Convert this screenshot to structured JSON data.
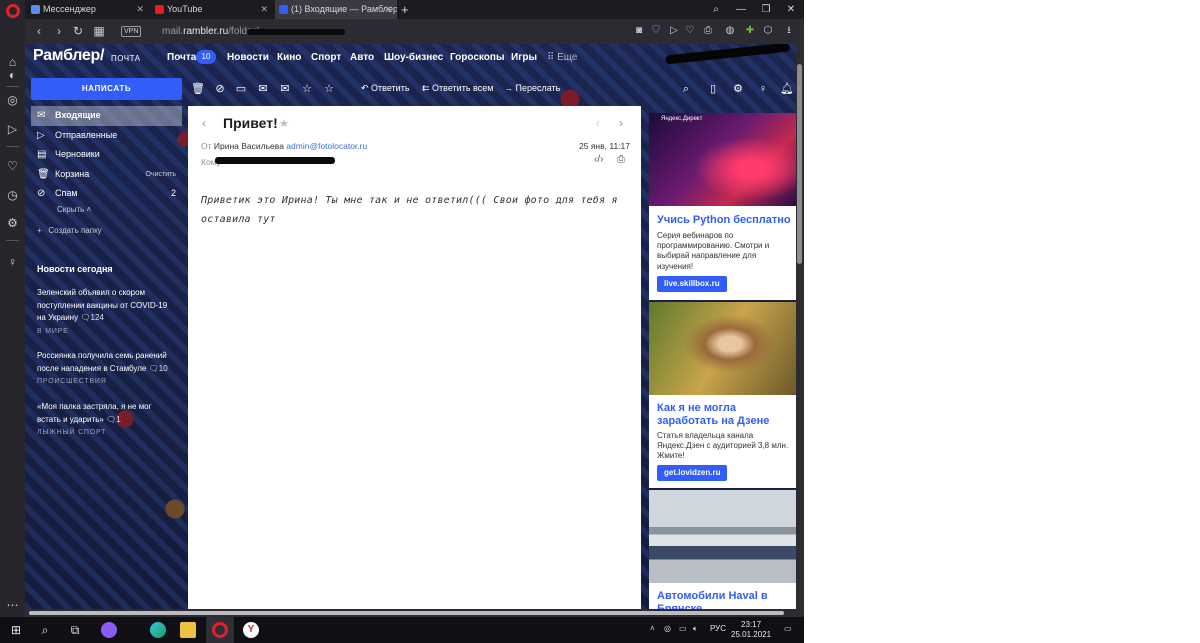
{
  "browser": {
    "tabs": [
      {
        "label": "Мессенджер",
        "icon": "messenger-icon"
      },
      {
        "label": "YouTube",
        "icon": "youtube-icon"
      },
      {
        "label": "(1) Входящие — Рамблер/",
        "icon": "mail-icon"
      }
    ],
    "vpn": "VPN",
    "url_prefix": "mail.",
    "url_domain": "rambler.ru",
    "url_path": "/folder/"
  },
  "header": {
    "logo": "Рамблер/",
    "logo_sub": "ПОЧТА",
    "nav": [
      "Почта",
      "Новости",
      "Кино",
      "Спорт",
      "Авто",
      "Шоу-бизнес",
      "Гороскопы",
      "Игры"
    ],
    "mail_count": "10",
    "more": "Еще"
  },
  "toolbar": {
    "compose": "НАПИСАТЬ",
    "reply": "Ответить",
    "reply_all": "Ответить всем",
    "forward": "Переслать"
  },
  "folders": [
    {
      "label": "Входящие",
      "icon": "inbox-icon",
      "active": true
    },
    {
      "label": "Отправленные",
      "icon": "sent-icon"
    },
    {
      "label": "Черновики",
      "icon": "drafts-icon"
    },
    {
      "label": "Корзина",
      "icon": "trash-icon",
      "action": "Очистить"
    },
    {
      "label": "Спам",
      "icon": "spam-icon",
      "count": "2"
    }
  ],
  "sidebar": {
    "hide": "Скрыть",
    "create_folder": "Создать папку",
    "news_heading": "Новости сегодня",
    "news": [
      {
        "text": "Зеленский объявил о скором поступлении вакцины от COVID-19 на Украину",
        "comments": "124",
        "category": "В МИРЕ"
      },
      {
        "text": "Россиянка получила семь ранений после нападения в Стамбуле",
        "comments": "10",
        "category": "ПРОИСШЕСТВИЯ"
      },
      {
        "text": "«Моя палка застряла, я не мог встать и ударить»",
        "comments": "1",
        "category": "ЛЫЖНЫЙ СПОРТ"
      }
    ]
  },
  "letter": {
    "subject": "Привет!",
    "from_label": "От",
    "from_name": "Ирина Васильева",
    "from_email": "admin@fotolocator.ru",
    "date": "25 янв, 11:17",
    "to_label": "Кому",
    "body": "Приветик это Ирина! Ты мне так и не ответил((( Свои фото для тебя я оставила тут"
  },
  "ads": [
    {
      "label": "Яндекс.Директ",
      "title": "Учись Python бесплатно",
      "text": "Серия вебинаров по программированию. Смотри и выбирай направление для изучения!",
      "button": "live.skillbox.ru"
    },
    {
      "title": "Как я не могла заработать на Дзене",
      "text": "Статья владельца канала Яндекс.Дзен с аудиторией 3,8 млн. Жмите!",
      "button": "get.lovidzen.ru"
    },
    {
      "title": "Автомобили Haval в Брянске"
    }
  ],
  "taskbar": {
    "lang": "РУС",
    "time": "23:17",
    "date": "25.01.2021"
  },
  "colors": {
    "accent": "#315efb",
    "page_bg": "#16203f",
    "browser_bg": "#1e1e22"
  }
}
